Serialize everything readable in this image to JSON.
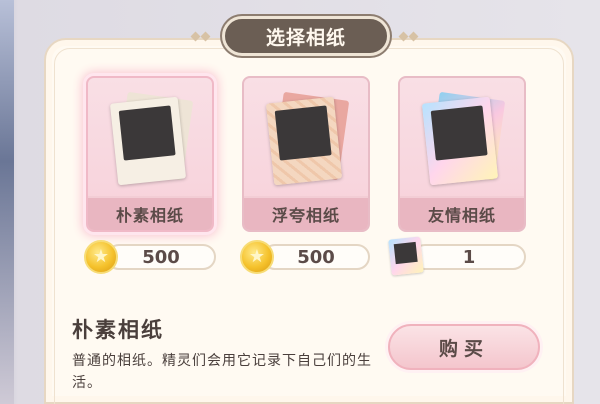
{
  "dialog": {
    "title": "选择相纸"
  },
  "papers": [
    {
      "name": "朴素相纸",
      "price": "500",
      "currency_icon": "gold-coin-icon",
      "selected": true
    },
    {
      "name": "浮夸相纸",
      "price": "500",
      "currency_icon": "gold-coin-icon",
      "selected": false
    },
    {
      "name": "友情相纸",
      "price": "1",
      "currency_icon": "photo-paper-ticket-icon",
      "selected": false
    }
  ],
  "detail": {
    "title": "朴素相纸",
    "description": "普通的相纸。精灵们会用它记录下自己们的生活。"
  },
  "buy_button": {
    "label": "购买"
  },
  "colors": {
    "accent": "#e9b6c1",
    "banner": "#6b5e54",
    "coin": "#f5c22c"
  }
}
